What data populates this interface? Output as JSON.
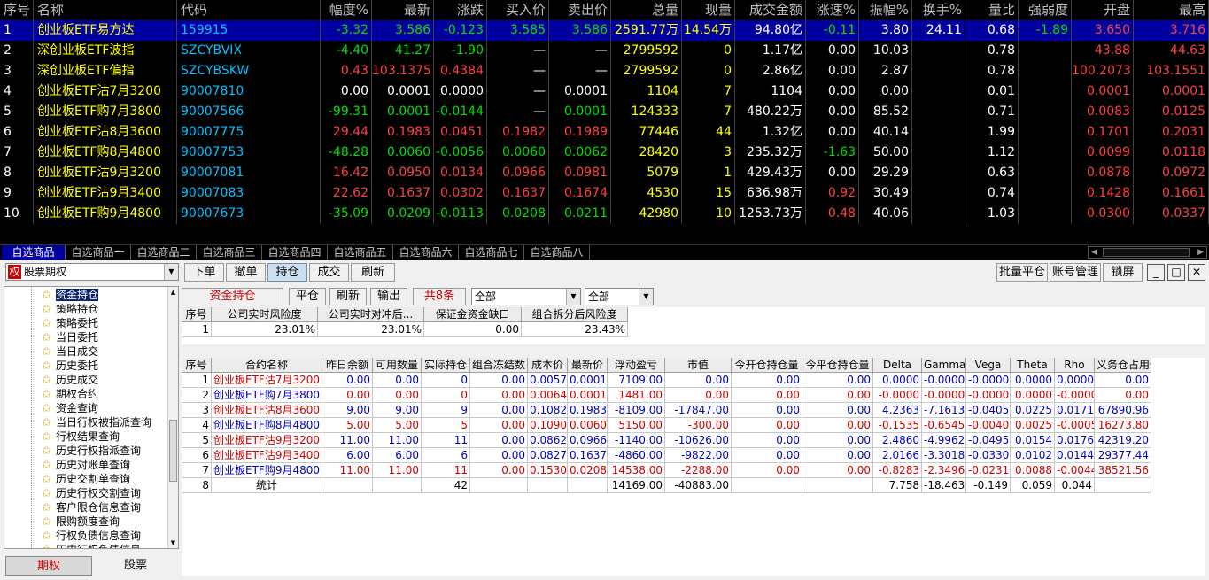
{
  "market": {
    "headers": [
      "序号",
      "名称",
      "代码",
      "幅度%",
      "最新",
      "涨跌",
      "买入价",
      "卖出价",
      "总量",
      "现量",
      "成交金额",
      "涨速%",
      "振幅%",
      "换手%",
      "量比",
      "强弱度",
      "开盘",
      "最高"
    ],
    "rows": [
      [
        "1",
        "创业板ETF易方达",
        "159915",
        "-3.32",
        "3.586",
        "-0.123",
        "3.585",
        "3.586",
        "2591.77万",
        "14.54万",
        "94.80亿",
        "-0.11",
        "3.80",
        "24.11",
        "0.68",
        "-1.89",
        "3.650",
        "3.716"
      ],
      [
        "2",
        "深创业板ETF波指",
        "SZCYBVIX",
        "-4.40",
        "41.27",
        "-1.90",
        "—",
        "—",
        "2799592",
        "0",
        "1.17亿",
        "0.00",
        "10.03",
        "",
        "0.78",
        "",
        "43.88",
        "44.63"
      ],
      [
        "3",
        "深创业板ETF偏指",
        "SZCYBSKW",
        "0.43",
        "103.1375",
        "0.4384",
        "—",
        "—",
        "2799592",
        "0",
        "2.86亿",
        "0.00",
        "2.87",
        "",
        "0.78",
        "",
        "100.2073",
        "103.1551"
      ],
      [
        "4",
        "创业板ETF沽7月3200",
        "90007810",
        "0.00",
        "0.0001",
        "0.0000",
        "—",
        "0.0001",
        "1104",
        "7",
        "1104",
        "0.00",
        "0.00",
        "",
        "0.01",
        "",
        "0.0001",
        "0.0001"
      ],
      [
        "5",
        "创业板ETF购7月3800",
        "90007566",
        "-99.31",
        "0.0001",
        "-0.0144",
        "—",
        "0.0001",
        "124333",
        "7",
        "480.22万",
        "0.00",
        "85.52",
        "",
        "0.71",
        "",
        "0.0083",
        "0.0125"
      ],
      [
        "6",
        "创业板ETF沽8月3600",
        "90007775",
        "29.44",
        "0.1983",
        "0.0451",
        "0.1982",
        "0.1989",
        "77446",
        "44",
        "1.32亿",
        "0.00",
        "40.14",
        "",
        "1.99",
        "",
        "0.1701",
        "0.2031"
      ],
      [
        "7",
        "创业板ETF购8月4800",
        "90007753",
        "-48.28",
        "0.0060",
        "-0.0056",
        "0.0060",
        "0.0062",
        "28420",
        "3",
        "235.32万",
        "-1.63",
        "50.00",
        "",
        "1.12",
        "",
        "0.0099",
        "0.0118"
      ],
      [
        "8",
        "创业板ETF沽9月3200",
        "90007081",
        "16.42",
        "0.0950",
        "0.0134",
        "0.0966",
        "0.0981",
        "5079",
        "1",
        "429.43万",
        "0.00",
        "29.29",
        "",
        "0.63",
        "",
        "0.0878",
        "0.0972"
      ],
      [
        "9",
        "创业板ETF沽9月3400",
        "90007083",
        "22.62",
        "0.1637",
        "0.0302",
        "0.1637",
        "0.1674",
        "4530",
        "15",
        "636.98万",
        "0.92",
        "30.49",
        "",
        "0.74",
        "",
        "0.1428",
        "0.1661"
      ],
      [
        "10",
        "创业板ETF购9月4800",
        "90007673",
        "-35.09",
        "0.0209",
        "-0.0113",
        "0.0208",
        "0.0211",
        "42980",
        "10",
        "1253.73万",
        "0.48",
        "40.06",
        "",
        "1.03",
        "",
        "0.0300",
        "0.0337"
      ]
    ]
  },
  "watchlist_tabs": [
    "自选商品",
    "自选商品一",
    "自选商品二",
    "自选商品三",
    "自选商品四",
    "自选商品五",
    "自选商品六",
    "自选商品七",
    "自选商品八"
  ],
  "category": {
    "badge": "权",
    "label": "股票期权"
  },
  "nav_items": [
    "资金持仓",
    "策略持仓",
    "策略委托",
    "当日委托",
    "当日成交",
    "历史委托",
    "历史成交",
    "期权合约",
    "资金查询",
    "当日行权被指派查询",
    "行权结果查询",
    "历史行权指派查询",
    "历史对账单查询",
    "历史交割单查询",
    "历史行权交割查询",
    "客户限仓信息查询",
    "限购额度查询",
    "行权负债信息查询",
    "历史行权负债信息"
  ],
  "bottom_tabs": [
    "期权",
    "股票"
  ],
  "toolbar_buttons": [
    "下单",
    "撤单",
    "持仓",
    "成交",
    "刷新"
  ],
  "right_buttons": [
    "批量平仓",
    "账号管理",
    "锁屏"
  ],
  "sub_toolbar": {
    "title": "资金持仓",
    "close": "平仓",
    "refresh": "刷新",
    "export": "输出",
    "count": "共8条",
    "filter1": "全部",
    "filter2": "全部"
  },
  "fund_table": {
    "headers": [
      "序号",
      "公司实时风险度",
      "公司实时对冲后...",
      "保证金资金缺口",
      "组合拆分后风险度"
    ],
    "rows": [
      [
        "1",
        "23.01%",
        "23.01%",
        "0.00",
        "23.43%"
      ]
    ]
  },
  "position_table": {
    "headers": [
      "序号",
      "合约名称",
      "昨日余额",
      "可用数量",
      "实际持仓",
      "组合冻结数",
      "成本价",
      "最新价",
      "浮动盈亏",
      "市值",
      "今开仓持仓量",
      "今平仓持仓量",
      "Delta",
      "Gamma",
      "Vega",
      "Theta",
      "Rho",
      "义务仓占用保..."
    ],
    "rows": [
      [
        "1",
        "创业板ETF沽7月3200",
        "0.00",
        "0.00",
        "0",
        "0.00",
        "0.0057",
        "0.0001",
        "7109.00",
        "0.00",
        "0.00",
        "0.00",
        "0.0000",
        "-0.0000",
        "-0.0000",
        "0.0000",
        "0.0000",
        "0.00"
      ],
      [
        "2",
        "创业板ETF购7月3800",
        "0.00",
        "0.00",
        "0",
        "0.00",
        "0.0064",
        "0.0001",
        "1481.00",
        "0.00",
        "0.00",
        "0.00",
        "-0.0000",
        "-0.0000",
        "-0.0000",
        "0.0000",
        "-0.0000",
        "0.00"
      ],
      [
        "3",
        "创业板ETF沽8月3600",
        "9.00",
        "9.00",
        "9",
        "0.00",
        "0.1082",
        "0.1983",
        "-8109.00",
        "-17847.00",
        "0.00",
        "0.00",
        "4.2363",
        "-7.1613",
        "-0.0405",
        "0.0225",
        "0.0171",
        "67890.96"
      ],
      [
        "4",
        "创业板ETF购8月4800",
        "5.00",
        "5.00",
        "5",
        "0.00",
        "0.1090",
        "0.0060",
        "5150.00",
        "-300.00",
        "0.00",
        "0.00",
        "-0.1535",
        "-0.6545",
        "-0.0040",
        "0.0025",
        "-0.0005",
        "16273.80"
      ],
      [
        "5",
        "创业板ETF沽9月3200",
        "11.00",
        "11.00",
        "11",
        "0.00",
        "0.0862",
        "0.0966",
        "-1140.00",
        "-10626.00",
        "0.00",
        "0.00",
        "2.4860",
        "-4.9962",
        "-0.0495",
        "0.0154",
        "0.0176",
        "42319.20"
      ],
      [
        "6",
        "创业板ETF沽9月3400",
        "6.00",
        "6.00",
        "6",
        "0.00",
        "0.0827",
        "0.1637",
        "-4860.00",
        "-9822.00",
        "0.00",
        "0.00",
        "2.0166",
        "-3.3018",
        "-0.0330",
        "0.0102",
        "0.0144",
        "29377.44"
      ],
      [
        "7",
        "创业板ETF购9月4800",
        "11.00",
        "11.00",
        "11",
        "0.00",
        "0.1530",
        "0.0208",
        "14538.00",
        "-2288.00",
        "0.00",
        "0.00",
        "-0.8283",
        "-2.3496",
        "-0.0231",
        "0.0088",
        "-0.0044",
        "38521.56"
      ]
    ],
    "summary": [
      "8",
      "统计",
      "",
      "",
      "42",
      "",
      "",
      "",
      "14169.00",
      "-40883.00",
      "",
      "",
      "7.758",
      "-18.463",
      "-0.149",
      "0.059",
      "0.044",
      ""
    ]
  },
  "colors": {
    "up": "#ff4040",
    "down": "#00e000",
    "yellow": "#ffff00",
    "cyan": "#00c0ff",
    "white": "#ffffff",
    "select": "#0000a0",
    "contract_red": "#d00000",
    "contract_blue": "#0000c0"
  }
}
